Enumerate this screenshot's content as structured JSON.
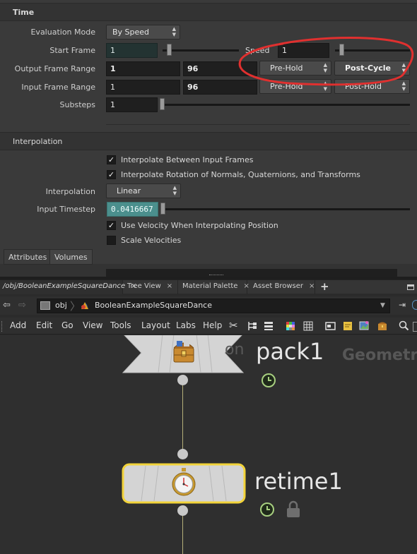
{
  "time_section": {
    "header": "Time",
    "evaluation_mode": {
      "label": "Evaluation Mode",
      "value": "By Speed"
    },
    "start_frame": {
      "label": "Start Frame",
      "value": "1"
    },
    "speed": {
      "label": "Speed",
      "value": "1"
    },
    "output_frame_range": {
      "label": "Output Frame Range",
      "start": "1",
      "end": "96",
      "pre": "Pre-Hold",
      "post": "Post-Cycle"
    },
    "input_frame_range": {
      "label": "Input Frame Range",
      "start": "1",
      "end": "96",
      "pre": "Pre-Hold",
      "post": "Post-Hold"
    },
    "substeps": {
      "label": "Substeps",
      "value": "1"
    }
  },
  "interpolation_section": {
    "header": "Interpolation",
    "interpolate_frames": {
      "label": "Interpolate Between Input Frames",
      "checked": true
    },
    "interpolate_rotation": {
      "label": "Interpolate Rotation of Normals, Quaternions, and Transforms",
      "checked": true
    },
    "interpolation": {
      "label": "Interpolation",
      "value": "Linear"
    },
    "input_timestep": {
      "label": "Input Timestep",
      "value": "0.0416667"
    },
    "use_velocity": {
      "label": "Use Velocity When Interpolating Position",
      "checked": true
    },
    "scale_velocities": {
      "label": "Scale Velocities",
      "checked": false
    }
  },
  "bottom_tabs": [
    "Attributes",
    "Volumes"
  ],
  "network_tabs": [
    {
      "label": "/obj/BooleanExampleSquareDance",
      "close": "×"
    },
    {
      "label": "Tree View",
      "close": "×"
    },
    {
      "label": "Material Palette",
      "close": "×"
    },
    {
      "label": "Asset Browser",
      "close": "×"
    }
  ],
  "add_tab": "+",
  "path": {
    "root": "obj",
    "current": "BooleanExampleSquareDance"
  },
  "menus": [
    "Add",
    "Edit",
    "Go",
    "View",
    "Tools",
    "Layout",
    "Labs",
    "Help"
  ],
  "nodes": {
    "pack": {
      "name": "pack1",
      "ghost_label": "on"
    },
    "retime": {
      "name": "retime1"
    },
    "context_label": "Geometry"
  },
  "colors": {
    "annotation_circle": "#e0302f",
    "selected_node_outline": "#f2d33a",
    "wire": "#b6b07a",
    "teal_field": "#4b8f8d",
    "display_flag": "#a8d080"
  },
  "icons": {
    "pack_node": "treasure-chest-icon",
    "retime_node": "stopwatch-icon",
    "flag": "clock-flag-icon",
    "lock": "lock-icon"
  }
}
